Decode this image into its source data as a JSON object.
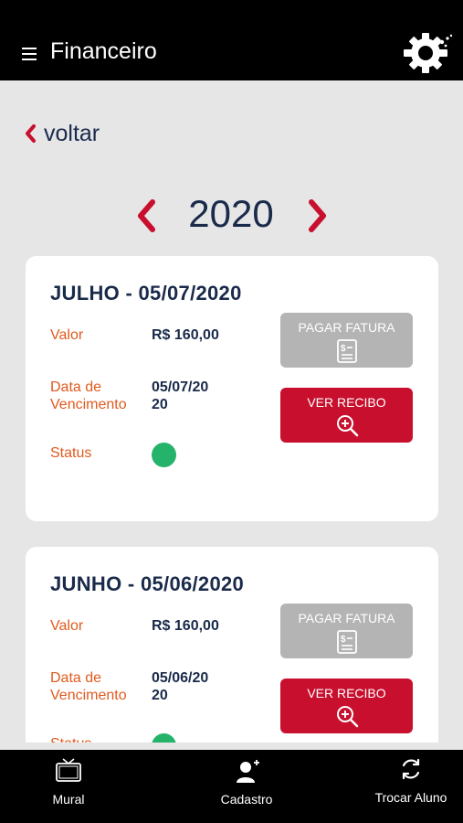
{
  "header": {
    "title": "Financeiro",
    "menu_icon": "hamburger-menu-icon",
    "settings_icon": "gear-icon"
  },
  "nav": {
    "back_label": "voltar"
  },
  "year_selector": {
    "year": "2020"
  },
  "colors": {
    "accent": "#c8102e",
    "navy": "#1a2a4a",
    "label_orange": "#e05a1e",
    "status_paid": "#25b36b",
    "disabled_grey": "#b4b4b4"
  },
  "invoices": [
    {
      "title": "JULHO - 05/07/2020",
      "value_label": "Valor",
      "value": "R$ 160,00",
      "due_label_line1": "Data de",
      "due_label_line2": "Vencimento",
      "due_line1": "05/07/20",
      "due_line2": "20",
      "status_label": "Status",
      "status": "paid",
      "pay_button": "PAGAR FATURA",
      "receipt_button": "VER RECIBO"
    },
    {
      "title": "JUNHO - 05/06/2020",
      "value_label": "Valor",
      "value": "R$ 160,00",
      "due_label_line1": "Data de",
      "due_label_line2": "Vencimento",
      "due_line1": "05/06/20",
      "due_line2": "20",
      "status_label": "Status",
      "status": "paid",
      "pay_button": "PAGAR FATURA",
      "receipt_button": "VER RECIBO"
    }
  ],
  "bottom_nav": [
    {
      "label": "Mural",
      "icon": "tv-icon"
    },
    {
      "label": "Cadastro",
      "icon": "add-user-icon"
    },
    {
      "label": "Trocar Aluno",
      "icon": "refresh-icon"
    }
  ]
}
